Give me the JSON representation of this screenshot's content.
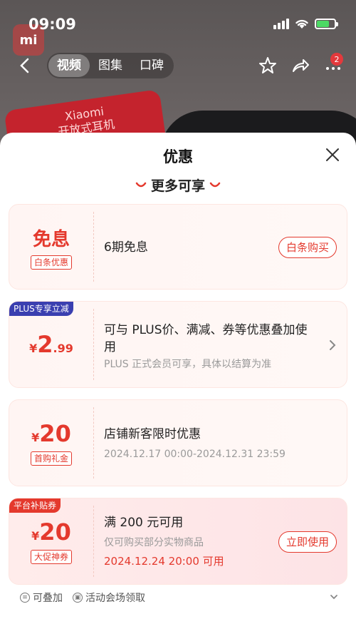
{
  "status_bar": {
    "time": "09:09"
  },
  "nav": {
    "tabs": [
      {
        "label": "视频",
        "active": true
      },
      {
        "label": "图集",
        "active": false
      },
      {
        "label": "口碑",
        "active": false
      }
    ],
    "more_badge": "2"
  },
  "background": {
    "logo": "mi",
    "product_text": "Xiaomi\n开放式耳机"
  },
  "sheet": {
    "title": "优惠",
    "section": "更多可享",
    "cards": [
      {
        "left_big": "免息",
        "left_tag": "白条优惠",
        "title": "6期免息",
        "button": "白条购买"
      },
      {
        "corner_tag": "PLUS专享立减",
        "currency": "¥",
        "amount_int": "2",
        "amount_dec": ".99",
        "title": "可与 PLUS价、满减、券等优惠叠加使用",
        "sub": "PLUS 正式会员可享，具体以结算为准"
      },
      {
        "currency": "¥",
        "amount": "20",
        "left_tag": "首购礼金",
        "title": "店铺新客限时优惠",
        "sub": "2024.12.17 00:00-2024.12.31 23:59"
      },
      {
        "corner_tag": "平台补贴券",
        "currency": "¥",
        "amount": "20",
        "left_tag": "大促神券",
        "title": "满 200 元可用",
        "sub": "仅可购买部分实物商品",
        "date": "2024.12.24 20:00 可用",
        "button": "立即使用"
      }
    ],
    "footer": {
      "stackable": "可叠加",
      "claim": "活动会场领取"
    }
  },
  "colors": {
    "accent": "#e4392d",
    "plus_tag": "#3a3fb0",
    "subsidy_tag": "#e4392d"
  }
}
